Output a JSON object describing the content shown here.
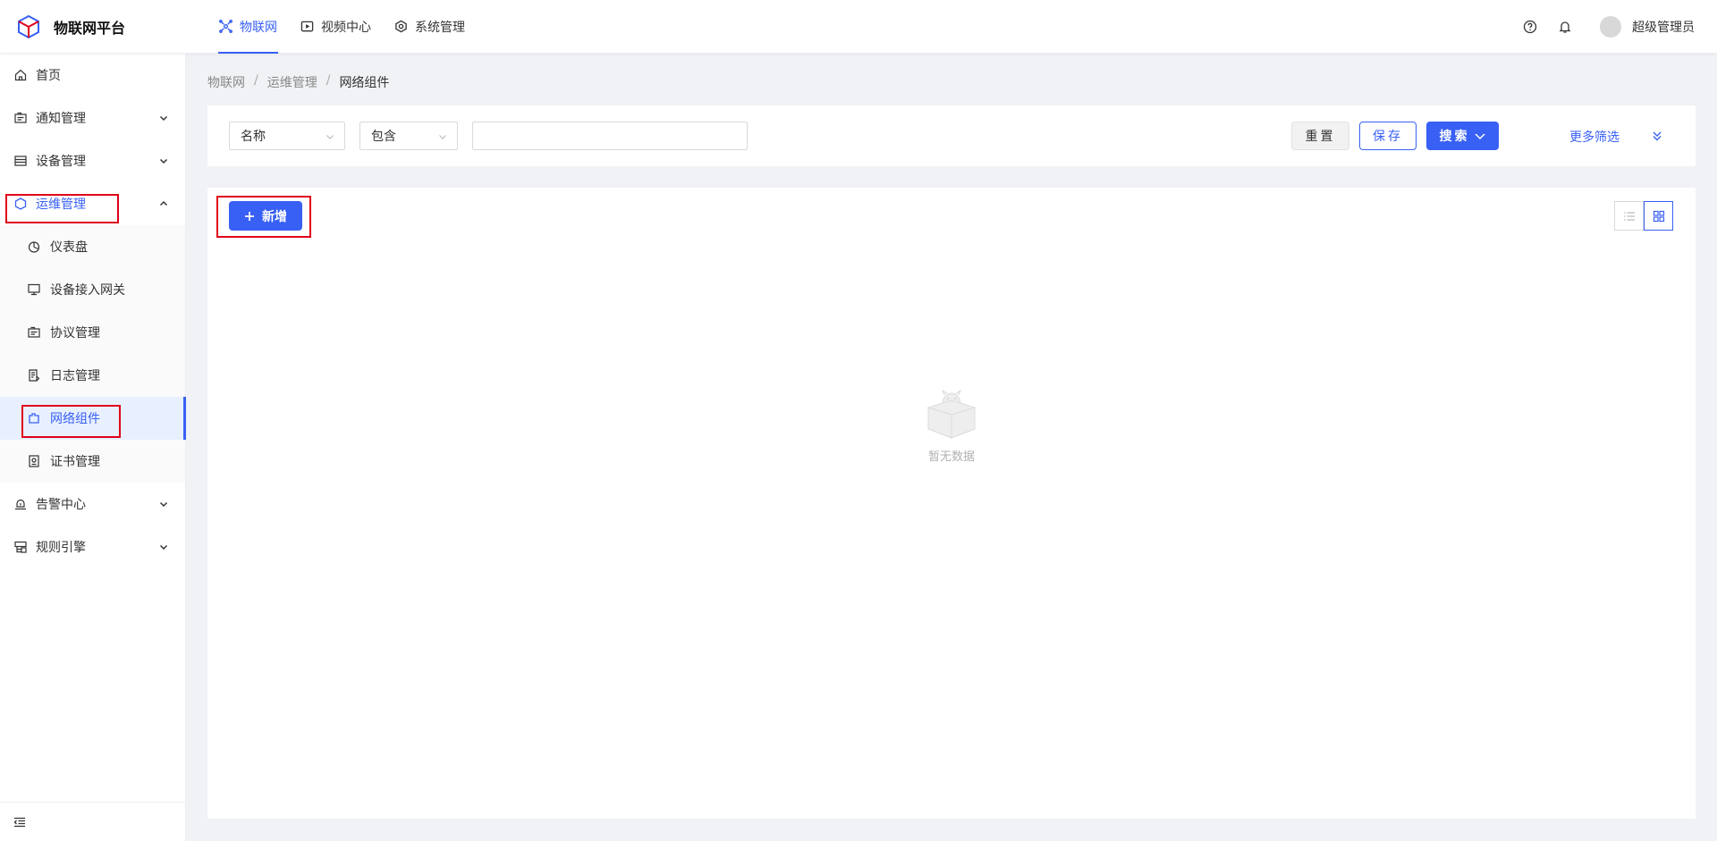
{
  "app": {
    "title": "物联网平台"
  },
  "topnav": [
    {
      "label": "物联网",
      "icon": "iot-icon",
      "active": true
    },
    {
      "label": "视频中心",
      "icon": "video-icon",
      "active": false
    },
    {
      "label": "系统管理",
      "icon": "system-icon",
      "active": false
    }
  ],
  "header": {
    "username": "超级管理员"
  },
  "sidebar": {
    "items": [
      {
        "label": "首页",
        "icon": "home-icon"
      },
      {
        "label": "通知管理",
        "icon": "notice-icon",
        "expandable": true
      },
      {
        "label": "设备管理",
        "icon": "device-icon",
        "expandable": true
      },
      {
        "label": "运维管理",
        "icon": "ops-icon",
        "expanded": true
      },
      {
        "label": "仪表盘",
        "icon": "dashboard-icon",
        "sub": true
      },
      {
        "label": "设备接入网关",
        "icon": "gateway-icon",
        "sub": true
      },
      {
        "label": "协议管理",
        "icon": "protocol-icon",
        "sub": true
      },
      {
        "label": "日志管理",
        "icon": "log-icon",
        "sub": true
      },
      {
        "label": "网络组件",
        "icon": "network-icon",
        "sub": true,
        "selected": true
      },
      {
        "label": "证书管理",
        "icon": "cert-icon",
        "sub": true
      },
      {
        "label": "告警中心",
        "icon": "alarm-icon",
        "expandable": true
      },
      {
        "label": "规则引擎",
        "icon": "rule-icon",
        "expandable": true
      }
    ]
  },
  "breadcrumb": [
    "物联网",
    "运维管理",
    "网络组件"
  ],
  "filter": {
    "field": "名称",
    "operator": "包含",
    "value": "",
    "reset_label": "重置",
    "save_label": "保存",
    "search_label": "搜索",
    "more_label": "更多筛选"
  },
  "content": {
    "add_label": "新增",
    "empty_text": "暂无数据",
    "view_mode": "card"
  },
  "colors": {
    "primary": "#3860f4",
    "highlight": "#e0001a"
  }
}
